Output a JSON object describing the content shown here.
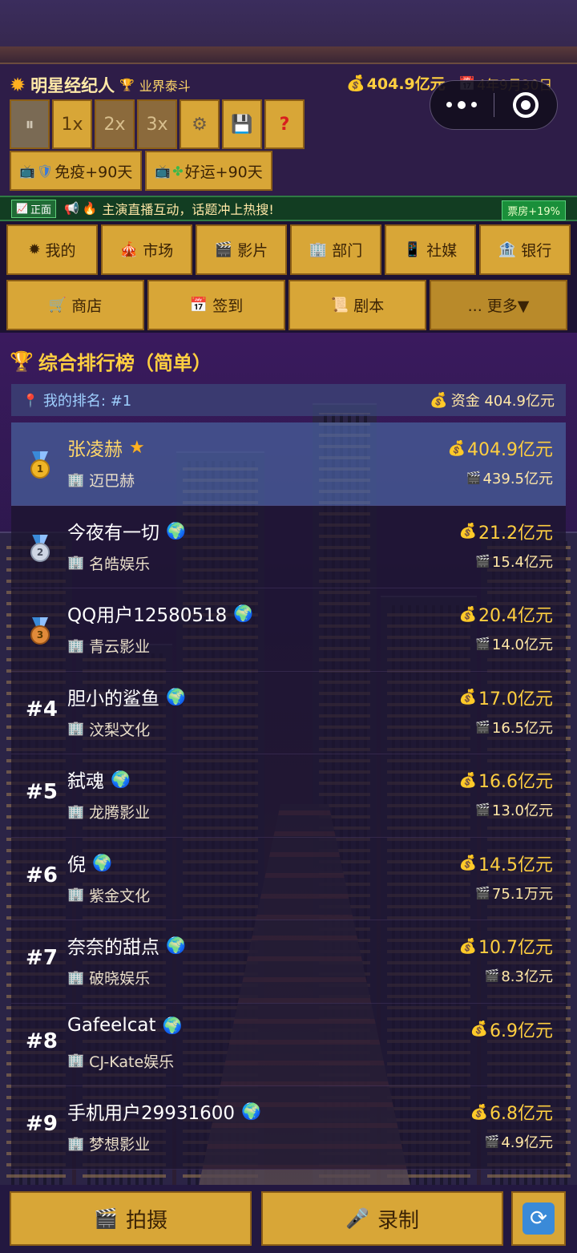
{
  "header": {
    "game_title": "明星经纪人",
    "rank_title": "业界泰斗",
    "money": "404.9亿元",
    "date": "4年9月30日"
  },
  "controls": {
    "speed_1x": "1x",
    "speed_2x": "2x",
    "speed_3x": "3x",
    "help": "?"
  },
  "buffs": [
    {
      "label": "免疫+90天"
    },
    {
      "label": "好运+90天"
    }
  ],
  "ticker": {
    "tag": "正面",
    "message": "主演直播互动，话题冲上热搜!",
    "box_office": "票房+19%"
  },
  "nav_primary": [
    {
      "label": "我的"
    },
    {
      "label": "市场"
    },
    {
      "label": "影片"
    },
    {
      "label": "部门"
    },
    {
      "label": "社媒"
    },
    {
      "label": "银行"
    }
  ],
  "nav_secondary": [
    {
      "label": "商店"
    },
    {
      "label": "签到"
    },
    {
      "label": "剧本"
    },
    {
      "label": "... 更多▼"
    }
  ],
  "ranking": {
    "title": "综合排行榜（简单）",
    "my_rank_label": "我的排名: #1",
    "my_funds_label": "资金 404.9亿元",
    "rows": [
      {
        "rank": "1",
        "name": "张凌赫",
        "company": "迈巴赫",
        "money": "404.9亿元",
        "box": "439.5亿元"
      },
      {
        "rank": "2",
        "name": "今夜有一切",
        "company": "名皓娱乐",
        "money": "21.2亿元",
        "box": "15.4亿元"
      },
      {
        "rank": "3",
        "name": "QQ用户12580518",
        "company": "青云影业",
        "money": "20.4亿元",
        "box": "14.0亿元"
      },
      {
        "rank": "#4",
        "name": "胆小的鲨鱼",
        "company": "汶梨文化",
        "money": "17.0亿元",
        "box": "16.5亿元"
      },
      {
        "rank": "#5",
        "name": "弑魂",
        "company": "龙腾影业",
        "money": "16.6亿元",
        "box": "13.0亿元"
      },
      {
        "rank": "#6",
        "name": "倪",
        "company": "紫金文化",
        "money": "14.5亿元",
        "box": "75.1万元"
      },
      {
        "rank": "#7",
        "name": "奈奈的甜点",
        "company": "破晓娱乐",
        "money": "10.7亿元",
        "box": "8.3亿元"
      },
      {
        "rank": "#8",
        "name": "Gafeelcat",
        "company": "CJ-Kate娱乐",
        "money": "6.9亿元",
        "box": ""
      },
      {
        "rank": "#9",
        "name": "手机用户29931600",
        "company": "梦想影业",
        "money": "6.8亿元",
        "box": "4.9亿元"
      }
    ]
  },
  "bottom": {
    "shoot_label": "拍摄",
    "record_label": "录制"
  }
}
